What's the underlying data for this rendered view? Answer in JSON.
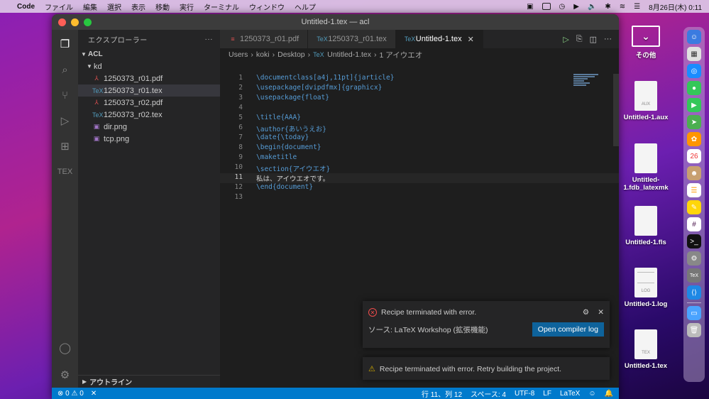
{
  "menubar": {
    "app": "Code",
    "items": [
      "ファイル",
      "編集",
      "選択",
      "表示",
      "移動",
      "実行",
      "ターミナル",
      "ウィンドウ",
      "ヘルプ"
    ],
    "clock": "8月26日(木) 0:11"
  },
  "window": {
    "title": "Untitled-1.tex — acl"
  },
  "sidebar": {
    "title": "エクスプローラー",
    "more": "···",
    "root": "ACL",
    "folder": "kd",
    "files": [
      {
        "name": "1250373_r01.pdf",
        "type": "pdf"
      },
      {
        "name": "1250373_r01.tex",
        "type": "tex"
      },
      {
        "name": "1250373_r02.pdf",
        "type": "pdf"
      },
      {
        "name": "1250373_r02.tex",
        "type": "tex"
      },
      {
        "name": "dir.png",
        "type": "png"
      },
      {
        "name": "tcp.png",
        "type": "png"
      }
    ],
    "outline": "アウトライン"
  },
  "tabs": [
    {
      "label": "1250373_r01.pdf"
    },
    {
      "label": "1250373_r01.tex"
    },
    {
      "label": "Untitled-1.tex"
    }
  ],
  "breadcrumb": [
    "Users",
    "koki",
    "Desktop",
    "Untitled-1.tex",
    "1 アイウエオ"
  ],
  "code_lines": [
    "\\documentclass[a4j,11pt]{jarticle}",
    "\\usepackage[dvipdfmx]{graphicx}",
    "\\usepackage{float}",
    "",
    "\\title{AAA}",
    "\\author{あいうえお}",
    "\\date{\\today}",
    "\\begin{document}",
    "\\maketitle",
    "\\section{アイウエオ}",
    "私は、アイウエオです。",
    "\\end{document}",
    ""
  ],
  "line_numbers": [
    "1",
    "2",
    "3",
    "4",
    "5",
    "6",
    "7",
    "8",
    "9",
    "10",
    "11",
    "12",
    "13"
  ],
  "notifications": {
    "error_title": "Recipe terminated with error.",
    "source": "ソース: LaTeX Workshop (拡張機能)",
    "button": "Open compiler log",
    "warning": "Recipe terminated with error. Retry building the project."
  },
  "statusbar": {
    "problems": "⊗ 0 ⚠ 0",
    "position": "行 11、列 12",
    "spaces": "スペース: 4",
    "encoding": "UTF-8",
    "eol": "LF",
    "language": "LaTeX"
  },
  "desktop": {
    "tv": "その他",
    "files": [
      {
        "name": "Untitled-1.aux",
        "badge": "AUX"
      },
      {
        "name": "Untitled-1.fdb_latexmk",
        "badge": ""
      },
      {
        "name": "Untitled-1.fls",
        "badge": ""
      },
      {
        "name": "Untitled-1.log",
        "badge": "LOG"
      },
      {
        "name": "Untitled-1.tex",
        "badge": "TEX"
      }
    ]
  }
}
